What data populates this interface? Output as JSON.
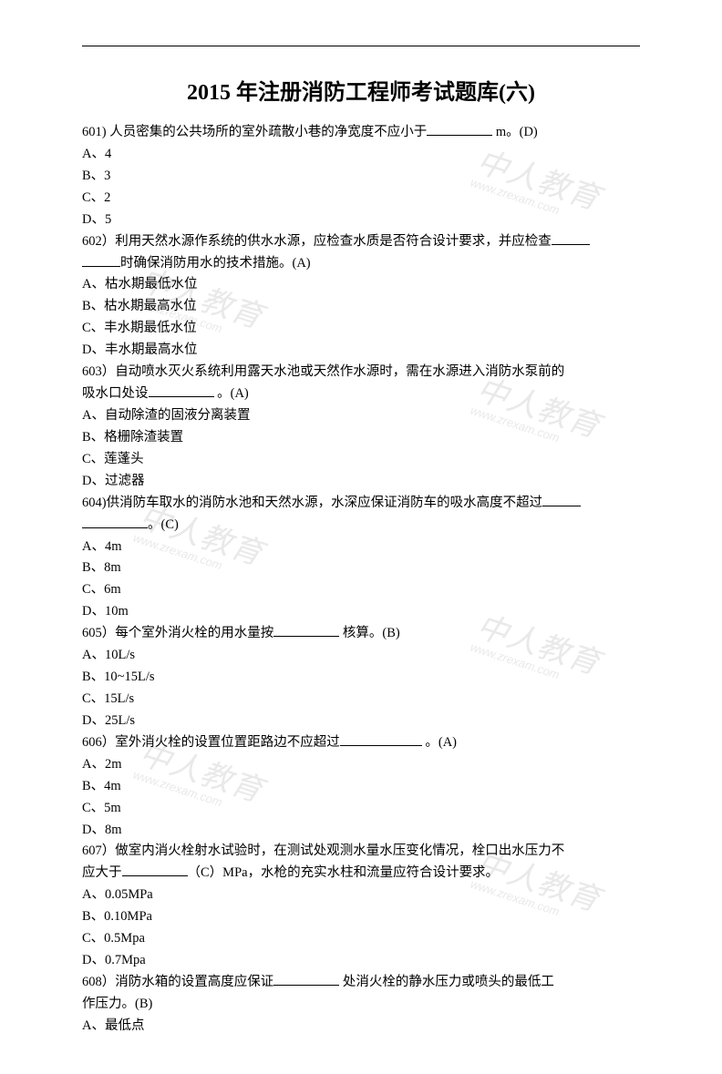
{
  "title": "2015 年注册消防工程师考试题库(六)",
  "watermark": {
    "main": "中人教育",
    "sub": "www.zrexam.com"
  },
  "questions": [
    {
      "num": "601)",
      "stem_pre": " 人员密集的公共场所的室外疏散小巷的净宽度不应小于",
      "stem_post": " m。(D)",
      "blank": "md",
      "options": [
        "A、4",
        "B、3",
        "C、2",
        "D、5"
      ]
    },
    {
      "num": "602）",
      "stem_pre": "利用天然水源作系统的供水水源，应检查水质是否符合设计要求，并应检查",
      "stem_post": "",
      "blank": "sm",
      "cont_pre": "",
      "cont_blank": "sm",
      "cont_post": "时确保消防用水的技术措施。(A)",
      "options": [
        "A、枯水期最低水位",
        "B、枯水期最高水位",
        "C、丰水期最低水位",
        "D、丰水期最高水位"
      ]
    },
    {
      "num": "603）",
      "stem_pre": "自动喷水灭火系统利用露天水池或天然作水源时，需在水源进入消防水泵前的",
      "stem_post": "",
      "blank": "",
      "cont_pre": "吸水口处设",
      "cont_blank": "md",
      "cont_post": " 。(A)",
      "options": [
        "A、自动除渣的固液分离装置",
        "B、格栅除渣装置",
        "C、莲蓬头",
        "D、过滤器"
      ]
    },
    {
      "num": "604)",
      "stem_pre": "供消防车取水的消防水池和天然水源，水深应保证消防车的吸水高度不超过",
      "stem_post": "",
      "blank": "sm",
      "cont_pre": "",
      "cont_blank": "md",
      "cont_post": "。(C)",
      "options": [
        "A、4m",
        "B、8m",
        "C、6m",
        "D、10m"
      ]
    },
    {
      "num": "605）",
      "stem_pre": "每个室外消火栓的用水量按",
      "stem_post": " 核算。(B)",
      "blank": "md",
      "options": [
        "A、10L/s",
        "B、10~15L/s",
        "C、15L/s",
        "D、25L/s"
      ]
    },
    {
      "num": "606）",
      "stem_pre": "室外消火栓的设置位置距路边不应超过",
      "stem_post": " 。(A)",
      "blank": "lg",
      "options": [
        "A、2m",
        "B、4m",
        "C、5m",
        "D、8m"
      ]
    },
    {
      "num": "607）",
      "stem_pre": "做室内消火栓射水试验时，在测试处观测水量水压变化情况，栓口出水压力不",
      "stem_post": "",
      "blank": "",
      "cont_pre": "应大于",
      "cont_blank": "md",
      "cont_post": "（C）MPa，水枪的充实水柱和流量应符合设计要求。",
      "options": [
        "A、0.05MPa",
        "B、0.10MPa",
        "C、0.5Mpa",
        "D、0.7Mpa"
      ]
    },
    {
      "num": "608）",
      "stem_pre": "消防水箱的设置高度应保证",
      "stem_post": " 处消火栓的静水压力或喷头的最低工",
      "blank": "md",
      "cont_pre": "作压力。(B)",
      "cont_blank": "",
      "cont_post": "",
      "options": [
        "A、最低点"
      ]
    }
  ]
}
